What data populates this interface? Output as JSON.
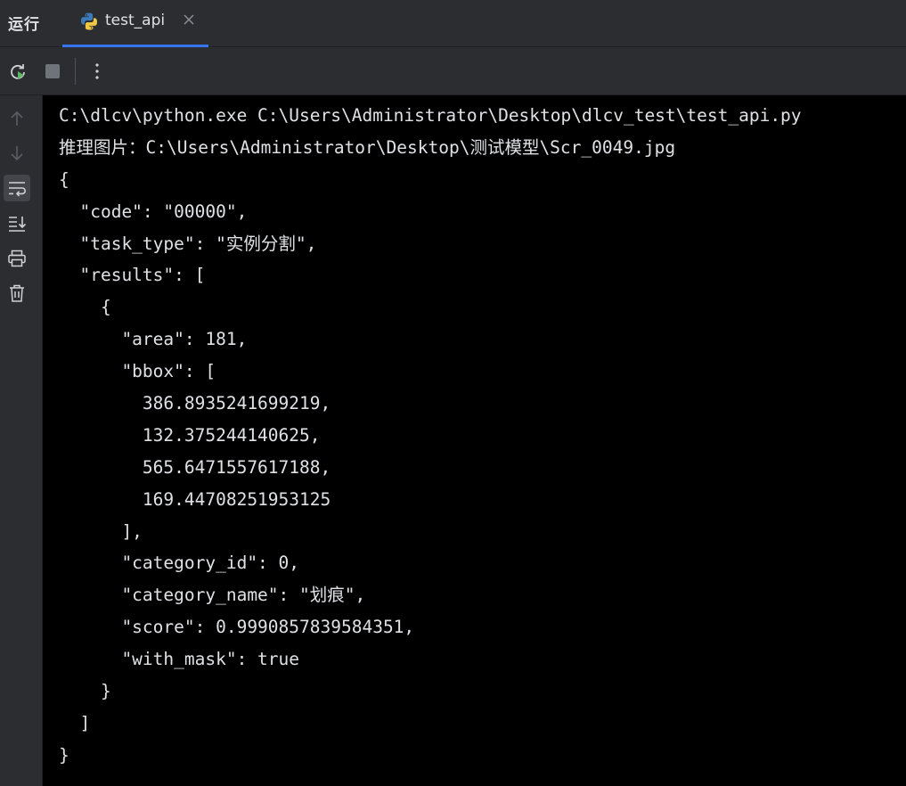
{
  "header": {
    "run_title": "运行",
    "tab": {
      "label": "test_api",
      "icon": "python-icon",
      "close_icon": "close-icon"
    }
  },
  "toolbar": {
    "buttons": [
      {
        "name": "rerun-icon"
      },
      {
        "name": "stop-icon"
      },
      {
        "name": "more-options-icon"
      }
    ]
  },
  "gutter": {
    "buttons": [
      {
        "name": "up-arrow-icon"
      },
      {
        "name": "down-arrow-icon"
      },
      {
        "name": "soft-wrap-icon",
        "active": true
      },
      {
        "name": "scroll-to-end-icon"
      },
      {
        "name": "print-icon"
      },
      {
        "name": "trash-icon"
      }
    ]
  },
  "console": {
    "lines": [
      "C:\\dlcv\\python.exe C:\\Users\\Administrator\\Desktop\\dlcv_test\\test_api.py",
      "推理图片：C:\\Users\\Administrator\\Desktop\\测试模型\\Scr_0049.jpg",
      "{",
      "  \"code\": \"00000\",",
      "  \"task_type\": \"实例分割\",",
      "  \"results\": [",
      "    {",
      "      \"area\": 181,",
      "      \"bbox\": [",
      "        386.8935241699219,",
      "        132.375244140625,",
      "        565.6471557617188,",
      "        169.44708251953125",
      "      ],",
      "      \"category_id\": 0,",
      "      \"category_name\": \"划痕\",",
      "      \"score\": 0.9990857839584351,",
      "      \"with_mask\": true",
      "    }",
      "  ]",
      "}"
    ]
  },
  "colors": {
    "panel_bg": "#2b2d30",
    "console_bg": "#000000",
    "text": "#dfe1e5",
    "accent": "#3574f0",
    "rerun_green": "#5fb865"
  }
}
